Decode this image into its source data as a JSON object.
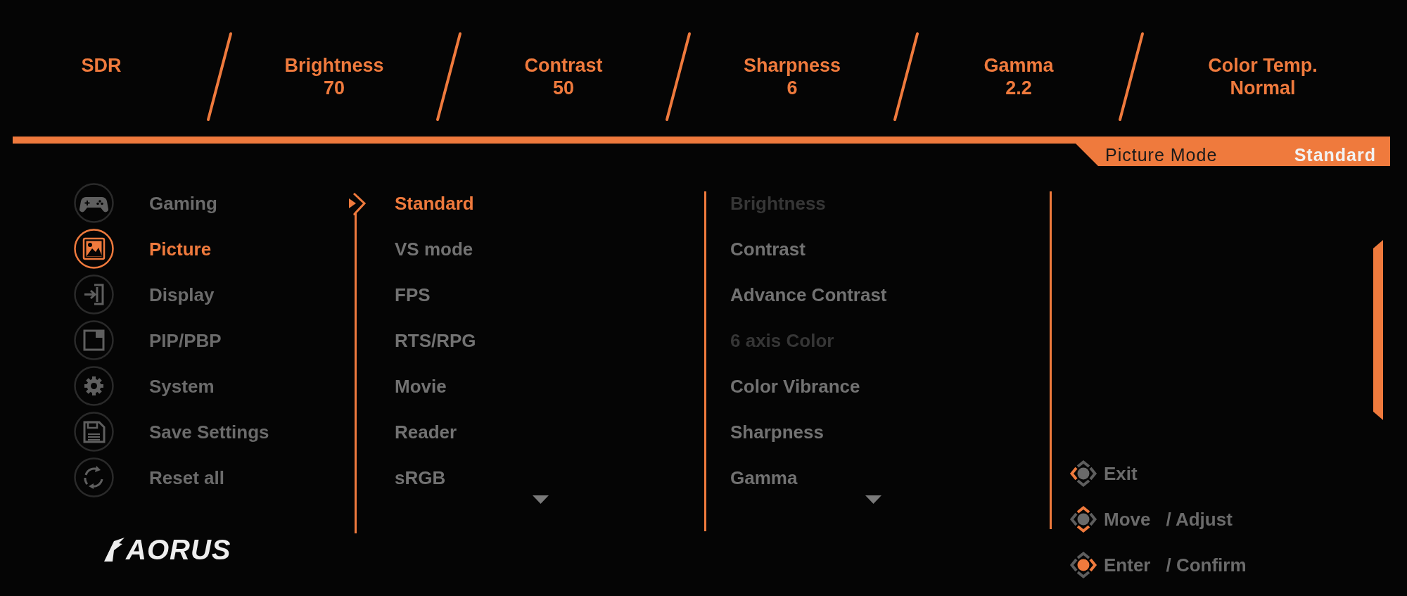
{
  "header": {
    "items": [
      {
        "label": "SDR"
      },
      {
        "label": "Brightness",
        "value": "70"
      },
      {
        "label": "Contrast",
        "value": "50"
      },
      {
        "label": "Sharpness",
        "value": "6"
      },
      {
        "label": "Gamma",
        "value": "2.2"
      },
      {
        "label": "Color Temp.",
        "value": "Normal"
      }
    ]
  },
  "picture_mode": {
    "label": "Picture Mode",
    "value": "Standard"
  },
  "sidebar": {
    "items": [
      {
        "label": "Gaming",
        "selected": false
      },
      {
        "label": "Picture",
        "selected": true
      },
      {
        "label": "Display",
        "selected": false
      },
      {
        "label": "PIP/PBP",
        "selected": false
      },
      {
        "label": "System",
        "selected": false
      },
      {
        "label": "Save Settings",
        "selected": false
      },
      {
        "label": "Reset all",
        "selected": false
      }
    ],
    "logo": "AORUS"
  },
  "presets": {
    "items": [
      {
        "label": "Standard",
        "selected": true
      },
      {
        "label": "VS mode",
        "selected": false
      },
      {
        "label": "FPS",
        "selected": false
      },
      {
        "label": "RTS/RPG",
        "selected": false
      },
      {
        "label": "Movie",
        "selected": false
      },
      {
        "label": "Reader",
        "selected": false
      },
      {
        "label": "sRGB",
        "selected": false
      }
    ],
    "more_below": true
  },
  "settings": {
    "items": [
      {
        "label": "Brightness",
        "disabled": true
      },
      {
        "label": "Contrast",
        "disabled": false
      },
      {
        "label": "Advance Contrast",
        "disabled": false
      },
      {
        "label": "6 axis Color",
        "disabled": true
      },
      {
        "label": "Color Vibrance",
        "disabled": false
      },
      {
        "label": "Sharpness",
        "disabled": false
      },
      {
        "label": "Gamma",
        "disabled": false
      }
    ],
    "more_below": true
  },
  "hints": [
    {
      "label": "Exit"
    },
    {
      "label": "Move",
      "action": "/ Adjust"
    },
    {
      "label": "Enter",
      "action": "/ Confirm"
    }
  ]
}
